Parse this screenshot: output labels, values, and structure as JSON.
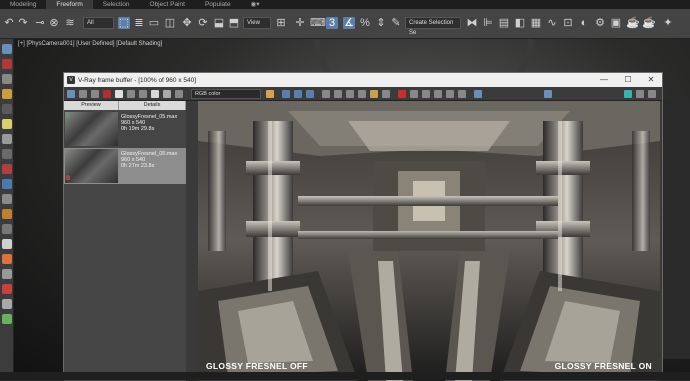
{
  "ribbon": {
    "tabs": [
      {
        "label": "Modeling"
      },
      {
        "label": "Freeform"
      },
      {
        "label": "Selection"
      },
      {
        "label": "Object Paint"
      },
      {
        "label": "Populate"
      }
    ]
  },
  "toolbar": {
    "filter_value": "All",
    "view_value": "View",
    "selection_set_placeholder": "Create Selection Se"
  },
  "viewport": {
    "label": "[+] [PhysCamera001] [User Defined] [Default Shading]"
  },
  "vfb": {
    "title": "V-Ray frame buffer - [100% of 960 x 540]",
    "channel_value": "RGB color",
    "history": {
      "headers": {
        "preview": "Preview",
        "details": "Details"
      },
      "rows": [
        {
          "name": "GlossyFresnel_05.max",
          "res": "960 x 540",
          "time": "0h 19m 29.8s",
          "badge_a": "A"
        },
        {
          "name": "GlossyFresnel_05.max",
          "res": "960 x 540",
          "time": "0h 27m 23.8s",
          "badge_b": "B"
        }
      ]
    },
    "render": {
      "caption_left": "GLOSSY FRESNEL OFF",
      "caption_right": "GLOSSY FRESNEL ON"
    }
  },
  "colors": {
    "accent": "#5c7ea8",
    "badge_a": "#3db34a",
    "badge_b": "#e0505a"
  }
}
